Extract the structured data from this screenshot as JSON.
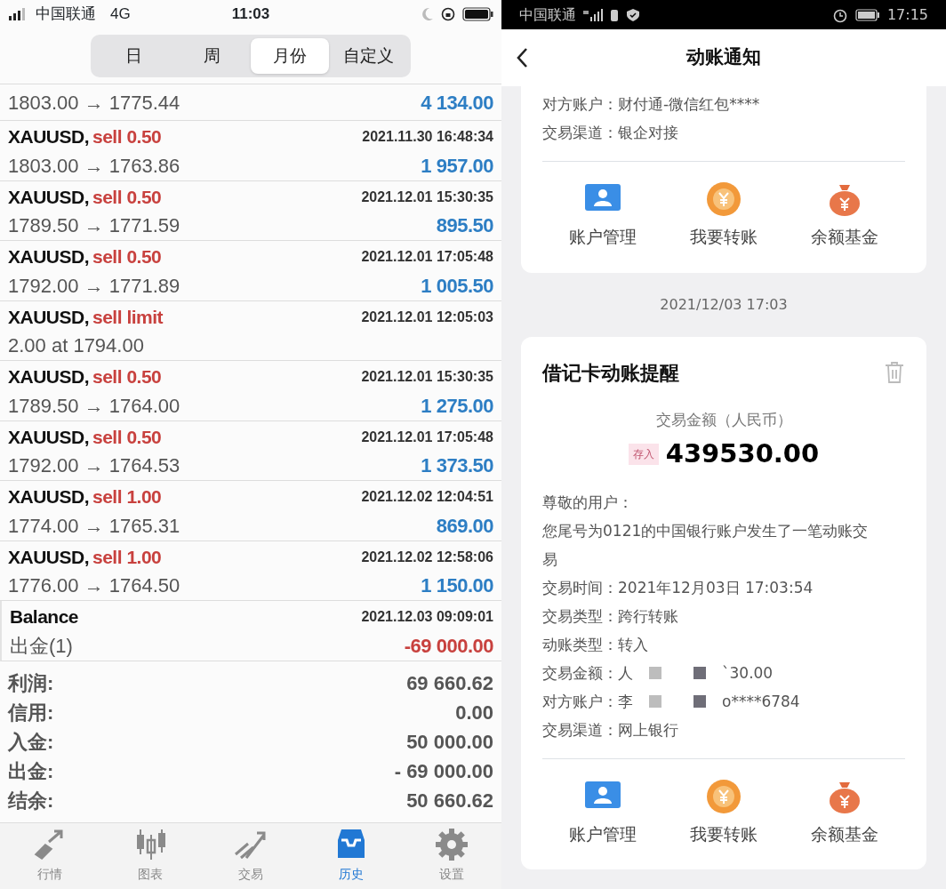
{
  "left": {
    "status_bar": {
      "carrier": "中国联通",
      "network": "4G",
      "time": "11:03"
    },
    "period_tabs": [
      {
        "label": "日",
        "selected": false
      },
      {
        "label": "周",
        "selected": false
      },
      {
        "label": "月份",
        "selected": true
      },
      {
        "label": "自定义",
        "selected": false
      }
    ],
    "partial_row": {
      "prices": "1803.00 → 1775.44",
      "amount": "4 134.00"
    },
    "deals": [
      {
        "kind": "trade",
        "symbol": "XAUUSD,",
        "action": "sell 0.50",
        "time": "2021.11.30 16:48:34",
        "prices": "1803.00 → 1763.86",
        "amount": "1 957.00"
      },
      {
        "kind": "trade",
        "symbol": "XAUUSD,",
        "action": "sell 0.50",
        "time": "2021.12.01 15:30:35",
        "prices": "1789.50 → 1771.59",
        "amount": "895.50"
      },
      {
        "kind": "trade",
        "symbol": "XAUUSD,",
        "action": "sell 0.50",
        "time": "2021.12.01 17:05:48",
        "prices": "1792.00 → 1771.89",
        "amount": "1 005.50"
      },
      {
        "kind": "order",
        "symbol": "XAUUSD,",
        "action": "sell limit",
        "time": "2021.12.01 12:05:03",
        "prices": "2.00 at 1794.00"
      },
      {
        "kind": "trade",
        "symbol": "XAUUSD,",
        "action": "sell 0.50",
        "time": "2021.12.01 15:30:35",
        "prices": "1789.50 → 1764.00",
        "amount": "1 275.00"
      },
      {
        "kind": "trade",
        "symbol": "XAUUSD,",
        "action": "sell 0.50",
        "time": "2021.12.01 17:05:48",
        "prices": "1792.00 → 1764.53",
        "amount": "1 373.50"
      },
      {
        "kind": "trade",
        "symbol": "XAUUSD,",
        "action": "sell 1.00",
        "time": "2021.12.02 12:04:51",
        "prices": "1774.00 → 1765.31",
        "amount": "869.00"
      },
      {
        "kind": "trade",
        "symbol": "XAUUSD,",
        "action": "sell 1.00",
        "time": "2021.12.02 12:58:06",
        "prices": "1776.00 → 1764.50",
        "amount": "1 150.00"
      },
      {
        "kind": "balance",
        "symbol": "Balance",
        "time": "2021.12.03 09:09:01",
        "prices": "出金(1)",
        "amount": "-69 000.00"
      }
    ],
    "summary": [
      {
        "label": "利润:",
        "value": "69 660.62"
      },
      {
        "label": "信用:",
        "value": "0.00"
      },
      {
        "label": "入金:",
        "value": "50 000.00"
      },
      {
        "label": "出金:",
        "value": "- 69 000.00"
      },
      {
        "label": "结余:",
        "value": "50 660.62"
      }
    ],
    "nav": [
      {
        "kind": "quotes",
        "label": "行情",
        "selected": false
      },
      {
        "kind": "chart",
        "label": "图表",
        "selected": false
      },
      {
        "kind": "trade",
        "label": "交易",
        "selected": false
      },
      {
        "kind": "history",
        "label": "历史",
        "selected": true
      },
      {
        "kind": "settings",
        "label": "设置",
        "selected": false
      }
    ]
  },
  "right": {
    "status_bar": {
      "carrier": "中国联通",
      "time": "17:15"
    },
    "header": {
      "title": "动账通知"
    },
    "previous_card": {
      "details": [
        {
          "label": "对方账户：",
          "value": [
            "财付通-微信红包****"
          ]
        },
        {
          "label": "交易渠道：",
          "value": [
            "银企对接"
          ]
        }
      ],
      "actions": [
        {
          "kind": "account",
          "label": "账户管理"
        },
        {
          "kind": "transfer",
          "label": "我要转账"
        },
        {
          "kind": "fund",
          "label": "余额基金"
        }
      ]
    },
    "date_separator": "2021/12/03 17:03",
    "notice_card": {
      "title": "借记卡动账提醒",
      "amount_caption": "交易金额（人民币）",
      "amount_tag": "存入",
      "amount": "439530.00",
      "greeting": "尊敬的用户：",
      "message": "您尾号为0121的中国银行账户发生了一笔动账交易",
      "details": [
        {
          "label": "交易时间：",
          "value": [
            "2021年12月03日 17:03:54"
          ]
        },
        {
          "label": "交易类型：",
          "value": [
            "跨行转账"
          ]
        },
        {
          "label": "动账类型：",
          "value": [
            "转入"
          ]
        },
        {
          "label": "交易金额：",
          "value": [
            "人",
            "`30.00"
          ]
        },
        {
          "label": "对方账户：",
          "value": [
            "李",
            "o****6784"
          ]
        },
        {
          "label": "交易渠道：",
          "value": [
            "网上银行"
          ]
        }
      ],
      "actions": [
        {
          "kind": "account",
          "label": "账户管理"
        },
        {
          "kind": "transfer",
          "label": "我要转账"
        },
        {
          "kind": "fund",
          "label": "余额基金"
        }
      ]
    }
  }
}
